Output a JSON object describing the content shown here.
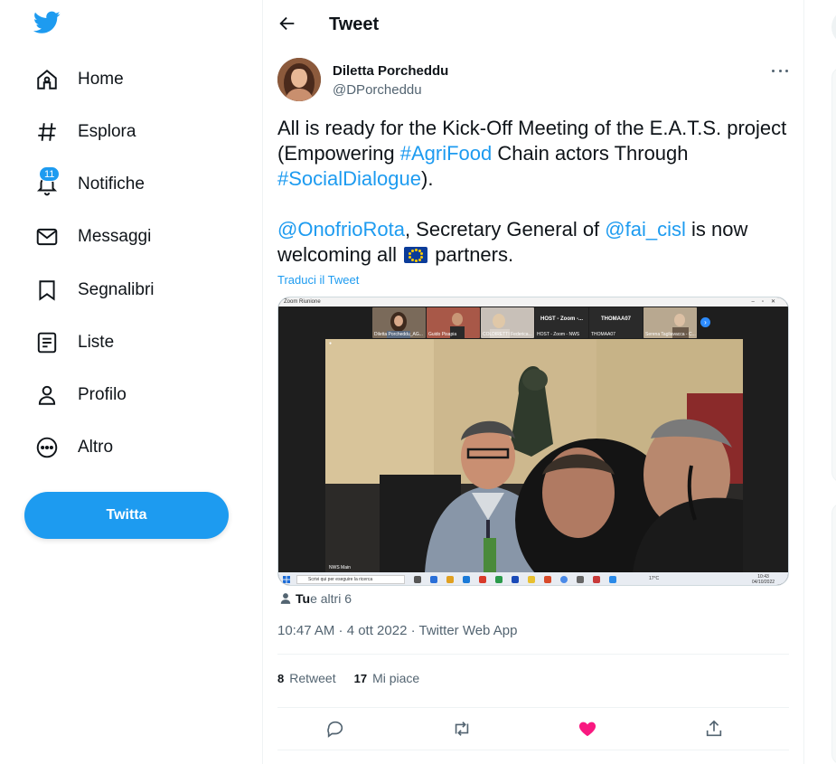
{
  "sidebar": {
    "items": [
      {
        "label": "Home",
        "icon": "home-icon"
      },
      {
        "label": "Esplora",
        "icon": "hashtag-icon"
      },
      {
        "label": "Notifiche",
        "icon": "bell-icon",
        "badge": "11"
      },
      {
        "label": "Messaggi",
        "icon": "envelope-icon"
      },
      {
        "label": "Segnalibri",
        "icon": "bookmark-icon"
      },
      {
        "label": "Liste",
        "icon": "list-icon"
      },
      {
        "label": "Profilo",
        "icon": "person-icon"
      },
      {
        "label": "Altro",
        "icon": "more-circle-icon"
      }
    ],
    "tweet_button": "Twitta"
  },
  "header": {
    "title": "Tweet"
  },
  "tweet": {
    "author_name": "Diletta Porcheddu",
    "author_handle": "@DPorcheddu",
    "text": {
      "p1_a": "All is ready for the Kick-Off Meeting of the E.A.T.S. project (Empowering ",
      "hashtag1": "#AgriFood",
      "p1_b": " Chain actors Through ",
      "hashtag2": "#SocialDialogue",
      "p1_c": ").",
      "mention1": "@OnofrioRota",
      "p2_a": ", Secretary General of ",
      "mention2": "@fai_cisl",
      "p2_b": " is now welcoming all ",
      "p2_c": " partners."
    },
    "translate": "Traduci il Tweet",
    "media": {
      "window_title": "Zoom Riunione",
      "participants": [
        {
          "name": "Diletta Porcheddu_AG...",
          "label": ""
        },
        {
          "name": "Guido Pisapia",
          "label": ""
        },
        {
          "name": "COLDIRETTI Federica...",
          "label": ""
        },
        {
          "name": "HOST - Zoom - NWS",
          "label": "HOST - Zoom -..."
        },
        {
          "name": "THOMAA07",
          "label": "THOMAA07"
        },
        {
          "name": "Serena Tagliavacca - C...",
          "label": ""
        }
      ],
      "video_caption": "NWS Main",
      "taskbar_search": "Scrivi qui per eseguire la ricerca",
      "taskbar_weather": "17°C",
      "taskbar_time": "10:43",
      "taskbar_date": "04/10/2022"
    },
    "likers": {
      "bold": "Tu",
      "rest": " e altri 6"
    },
    "timestamp": "10:47 AM · 4 ott 2022 · Twitter Web App",
    "retweets": {
      "count": "8",
      "label": "Retweet"
    },
    "likes": {
      "count": "17",
      "label": "Mi piace"
    }
  },
  "colors": {
    "accent": "#1d9bf0",
    "like": "#f91880",
    "text": "#0f1419",
    "muted": "#536471"
  }
}
